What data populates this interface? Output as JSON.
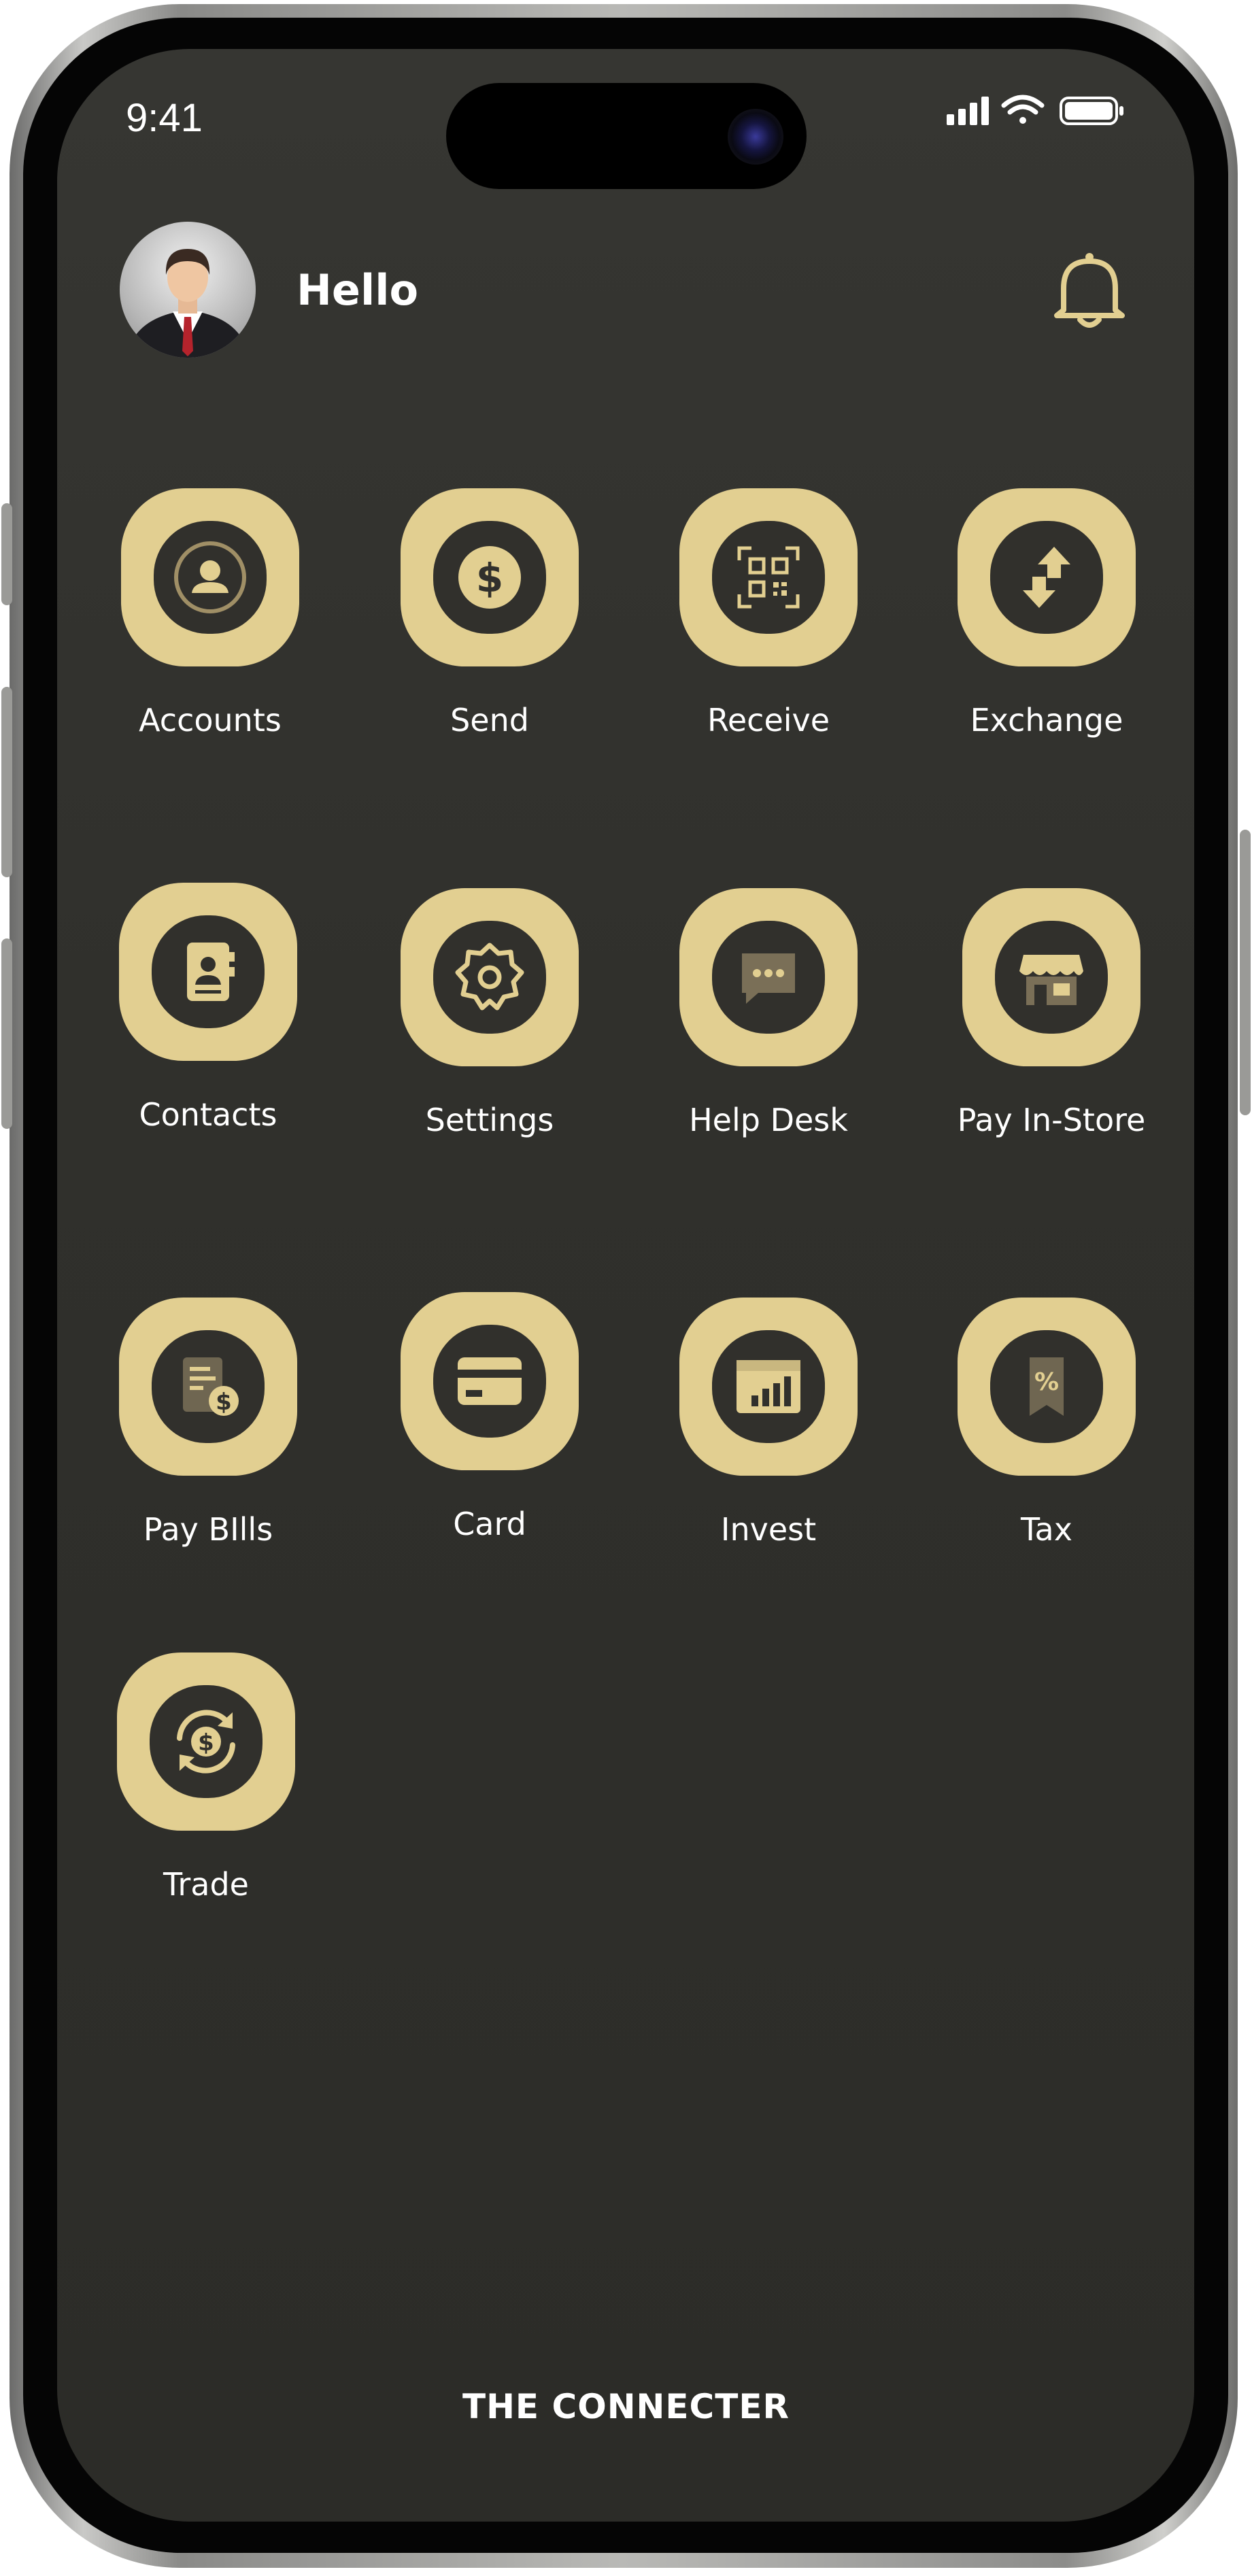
{
  "status_bar": {
    "time": "9:41"
  },
  "header": {
    "greeting": "Hello"
  },
  "grid": [
    {
      "label": "Accounts",
      "icon": "account-user-icon"
    },
    {
      "label": "Send",
      "icon": "dollar-coin-icon"
    },
    {
      "label": "Receive",
      "icon": "qr-code-icon"
    },
    {
      "label": "Exchange",
      "icon": "exchange-arrows-icon"
    },
    {
      "label": "Contacts",
      "icon": "contact-book-icon"
    },
    {
      "label": "Settings",
      "icon": "gear-icon"
    },
    {
      "label": "Help Desk",
      "icon": "chat-bubble-icon"
    },
    {
      "label": "Pay In-Store",
      "icon": "store-icon"
    },
    {
      "label": "Pay BIlls",
      "icon": "bill-dollar-icon"
    },
    {
      "label": "Card",
      "icon": "credit-card-icon"
    },
    {
      "label": "Invest",
      "icon": "bar-chart-icon"
    },
    {
      "label": "Tax",
      "icon": "tax-percent-icon"
    },
    {
      "label": "Trade",
      "icon": "trade-cycle-icon"
    }
  ],
  "footer": {
    "brand": "THE CONNECTER"
  },
  "colors": {
    "accent": "#e2cf91",
    "background": "#2f2f2b",
    "text": "#ffffff"
  }
}
